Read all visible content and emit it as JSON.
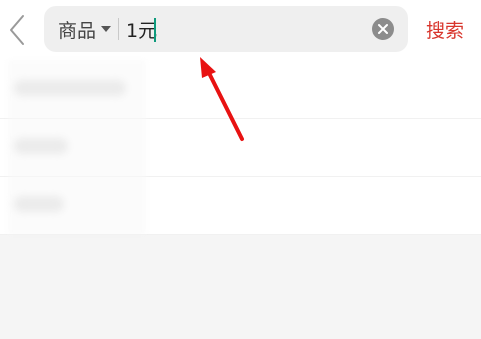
{
  "search": {
    "category": "商品",
    "value": "1元",
    "button_label": "搜索"
  },
  "suggestions": [
    "",
    "",
    ""
  ],
  "colors": {
    "accent": "#d8352c",
    "caret": "#0d9a7c",
    "annotation_arrow": "#e81212"
  },
  "icons": {
    "back": "back-chevron-icon",
    "clear": "clear-circle-x-icon",
    "category_dropdown": "caret-down-icon"
  }
}
